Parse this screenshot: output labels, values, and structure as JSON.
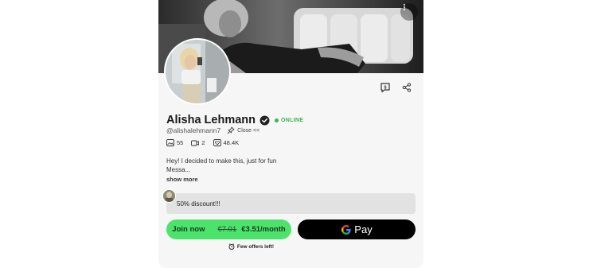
{
  "profile": {
    "name": "Alisha Lehmann",
    "status": "ONLINE",
    "handle": "@alishalehmann7",
    "close_label": "Close <<",
    "stats": {
      "posts": "55",
      "media": "2",
      "likes": "48.4K"
    },
    "bio_line1": "Hey! I decided to make this, just for fun",
    "bio_line2": "Messa...",
    "show_more": "show more"
  },
  "promo": {
    "text": "50% discount!!!"
  },
  "subscribe": {
    "join_label": "Join now",
    "old_price": "€7.01",
    "new_price": "€3.51/month",
    "gpay_label": "Pay",
    "few_offers": "Few offers left!"
  },
  "icons": {
    "cover_menu": "more-vertical-icon",
    "tip": "tip-message-icon",
    "share": "share-icon",
    "verified": "verified-icon",
    "pin": "pin-icon",
    "posts": "image-icon",
    "media": "video-icon",
    "likes": "heart-icon"
  },
  "colors": {
    "accent_green": "#4ce36b",
    "online_green": "#39b54a",
    "card_bg": "#f6f6f6",
    "promo_bg": "#e2e2e2",
    "gpay_bg": "#000000"
  }
}
